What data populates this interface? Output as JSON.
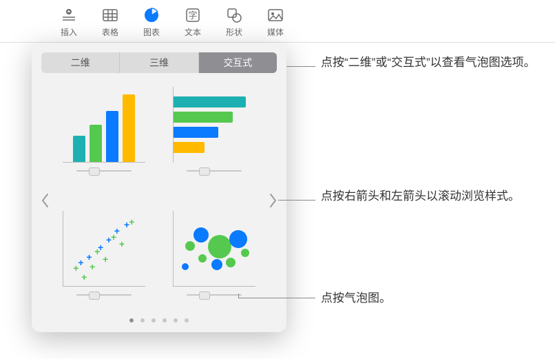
{
  "toolbar": {
    "insert": "插入",
    "table": "表格",
    "chart": "图表",
    "text": "文本",
    "shape": "形状",
    "media": "媒体"
  },
  "popover": {
    "tabs": {
      "two_d": "二维",
      "three_d": "三维",
      "interactive": "交互式"
    }
  },
  "callouts": {
    "tabs": "点按“二维”或“交互式”以查看气泡图选项。",
    "arrows": "点按右箭头和左箭头以滚动浏览样式。",
    "bubble": "点按气泡图。"
  }
}
